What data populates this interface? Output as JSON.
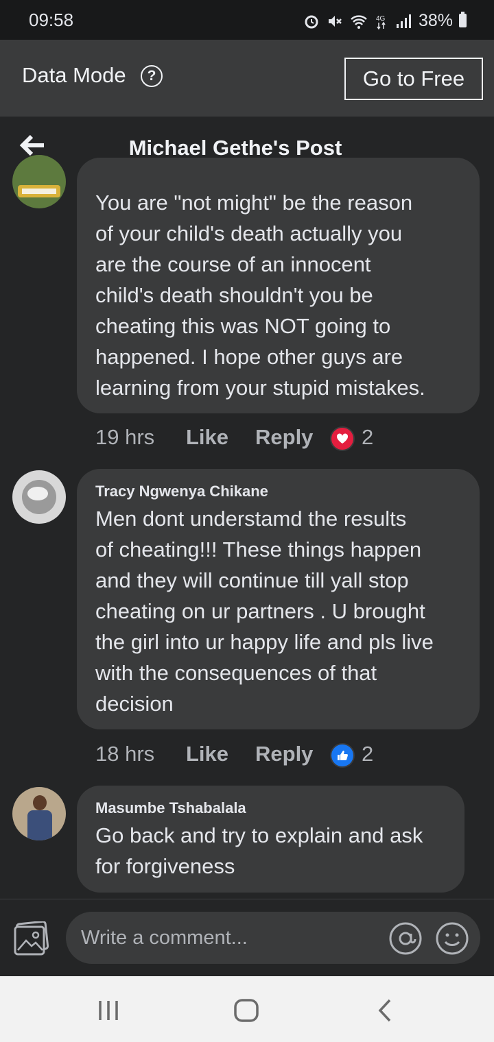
{
  "status_bar": {
    "time": "09:58",
    "battery": "38%"
  },
  "banner": {
    "label": "Data Mode",
    "help_glyph": "?",
    "button": "Go to Free"
  },
  "header": {
    "title": "Michael Gethe's Post"
  },
  "comments": [
    {
      "author": "",
      "text_lines": [
        "You are \"not might\" be the reason",
        "of your child's death  actually you",
        "are the course of an innocent",
        "child's death shouldn't you be",
        "cheating this was NOT going to",
        "happened. I hope other guys are",
        "learning from your stupid mistakes."
      ],
      "time": "19 hrs",
      "like": "Like",
      "reply": "Reply",
      "reaction_icon": "heart-icon",
      "reaction_count": "2"
    },
    {
      "author": "Tracy Ngwenya Chikane",
      "text_lines": [
        "Men dont understamd the results",
        "of cheating!!! These things happen",
        "and they will continue till yall stop",
        "cheating on ur partners .  U brought",
        "the girl into ur happy life and pls live",
        "with the consequences of that",
        "decision"
      ],
      "time": "18 hrs",
      "like": "Like",
      "reply": "Reply",
      "reaction_icon": "thumbs-up-icon",
      "reaction_count": "2"
    },
    {
      "author": "Masumbe Tshabalala",
      "text_lines": [
        "Go back and try to explain and ask",
        "for forgiveness"
      ]
    }
  ],
  "composer": {
    "placeholder": "Write a comment..."
  },
  "colors": {
    "background": "#242526",
    "bubble": "#3a3b3c",
    "heart": "#e41e3f",
    "like_blue": "#1877f2"
  }
}
